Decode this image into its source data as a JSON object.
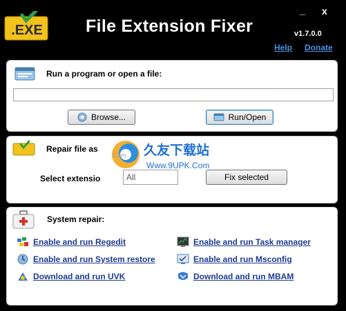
{
  "header": {
    "logo_text": ".EXE",
    "title": "File Extension Fixer",
    "version": "v1.7.0.0",
    "help_label": "Help",
    "donate_label": "Donate",
    "minimize_label": "_",
    "close_label": "x"
  },
  "run_section": {
    "label": "Run a program or open a file:",
    "input_value": "",
    "browse_label": "Browse...",
    "run_label": "Run/Open"
  },
  "repair_section": {
    "label": "Repair file as",
    "select_label": "Select extensio",
    "select_value": "All",
    "fix_label": "Fix selected"
  },
  "system_section": {
    "label": "System repair:",
    "links_left": [
      {
        "label": "Enable and run Regedit"
      },
      {
        "label": "Enable and run System restore"
      },
      {
        "label": "Download and run UVK"
      }
    ],
    "links_right": [
      {
        "label": "Enable and run Task manager"
      },
      {
        "label": "Enable and run Msconfig"
      },
      {
        "label": "Download and run MBAM"
      }
    ]
  },
  "watermark": {
    "site_cn": "久友下载站",
    "site_url": "Www.9UPK.Com",
    "small_text": "Www.9UPK.Com"
  },
  "colors": {
    "background": "#000000",
    "panel": "#ffffff",
    "link": "#1f3a93",
    "top_link": "#4a90e2",
    "logo_yellow": "#f3c21b"
  }
}
